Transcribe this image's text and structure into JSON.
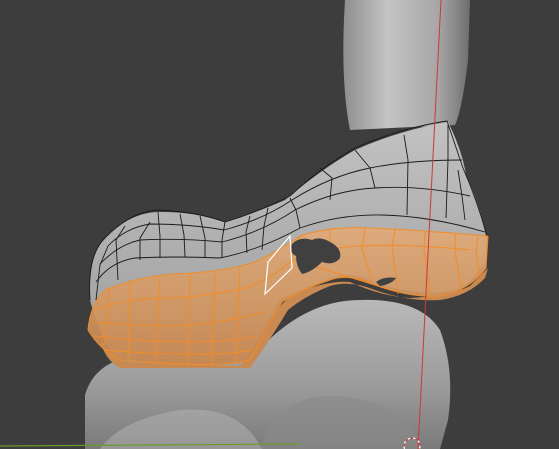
{
  "viewport": {
    "background_color": "#3d3d3d",
    "mode": "edit-mode"
  },
  "mesh": {
    "surface_color": "#a9a9a9",
    "wireframe_color": "#1a1a1a",
    "selected_face_color": "#d9a06a",
    "selected_edge_color": "#f28c28",
    "active_face_outline_color": "#ffffff"
  },
  "overlays": {
    "z_axis_color": "#c83a3a",
    "floor_line_color": "#6a9a2a",
    "cursor_icon": "3d-cursor-icon"
  }
}
